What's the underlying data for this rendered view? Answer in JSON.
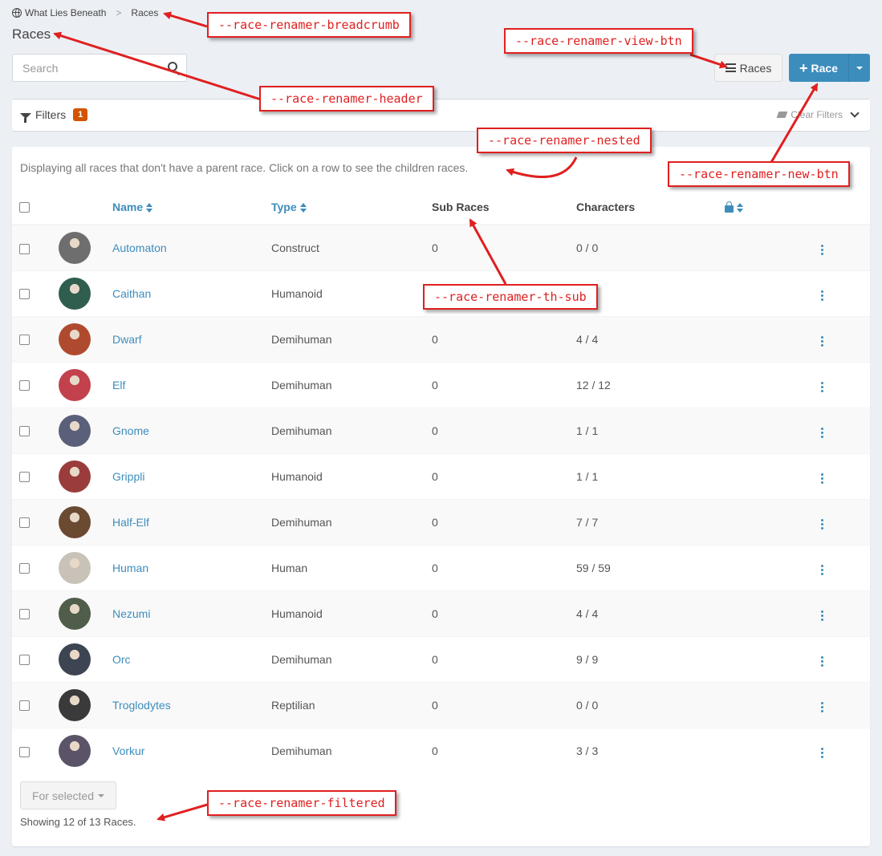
{
  "breadcrumb": {
    "world": "What Lies Beneath",
    "separator": ">",
    "current": "Races"
  },
  "page": {
    "title": "Races"
  },
  "search": {
    "placeholder": "Search"
  },
  "toolbar": {
    "view_label": "Races",
    "new_label": "Race"
  },
  "filters": {
    "label": "Filters",
    "count": "1",
    "clear_label": "Clear Filters"
  },
  "list": {
    "description": "Displaying all races that don't have a parent race. Click on a row to see the children races.",
    "columns": {
      "name": "Name",
      "type": "Type",
      "sub_races": "Sub Races",
      "characters": "Characters"
    },
    "rows": [
      {
        "name": "Automaton",
        "type": "Construct",
        "sub": "0",
        "chars": "0 / 0",
        "color": "#6e6e6e"
      },
      {
        "name": "Caithan",
        "type": "Humanoid",
        "sub": "",
        "chars": "",
        "color": "#2f5e4e"
      },
      {
        "name": "Dwarf",
        "type": "Demihuman",
        "sub": "0",
        "chars": "4 / 4",
        "color": "#b04a2e"
      },
      {
        "name": "Elf",
        "type": "Demihuman",
        "sub": "0",
        "chars": "12 / 12",
        "color": "#c2414d"
      },
      {
        "name": "Gnome",
        "type": "Demihuman",
        "sub": "0",
        "chars": "1 / 1",
        "color": "#5a5f7a"
      },
      {
        "name": "Grippli",
        "type": "Humanoid",
        "sub": "0",
        "chars": "1 / 1",
        "color": "#9a3c3c"
      },
      {
        "name": "Half-Elf",
        "type": "Demihuman",
        "sub": "0",
        "chars": "7 / 7",
        "color": "#6b4a32"
      },
      {
        "name": "Human",
        "type": "Human",
        "sub": "0",
        "chars": "59 / 59",
        "color": "#c9c2b8"
      },
      {
        "name": "Nezumi",
        "type": "Humanoid",
        "sub": "0",
        "chars": "4 / 4",
        "color": "#4f5d4a"
      },
      {
        "name": "Orc",
        "type": "Demihuman",
        "sub": "0",
        "chars": "9 / 9",
        "color": "#3d4552"
      },
      {
        "name": "Troglodytes",
        "type": "Reptilian",
        "sub": "0",
        "chars": "0 / 0",
        "color": "#3a3a3a"
      },
      {
        "name": "Vorkur",
        "type": "Demihuman",
        "sub": "0",
        "chars": "3 / 3",
        "color": "#5b5468"
      }
    ]
  },
  "footer": {
    "for_selected": "For selected",
    "showing": "Showing 12 of 13 Races."
  },
  "annotations": {
    "breadcrumb": "--race-renamer-breadcrumb",
    "header": "--race-renamer-header",
    "view_btn": "--race-renamer-view-btn",
    "new_btn": "--race-renamer-new-btn",
    "nested": "--race-renamer-nested",
    "th_sub": "--race-renamer-th-sub",
    "filtered": "--race-renamer-filtered"
  },
  "colors": {
    "accent": "#3c8dbc",
    "badge": "#d35400",
    "annotation": "#e02020"
  }
}
